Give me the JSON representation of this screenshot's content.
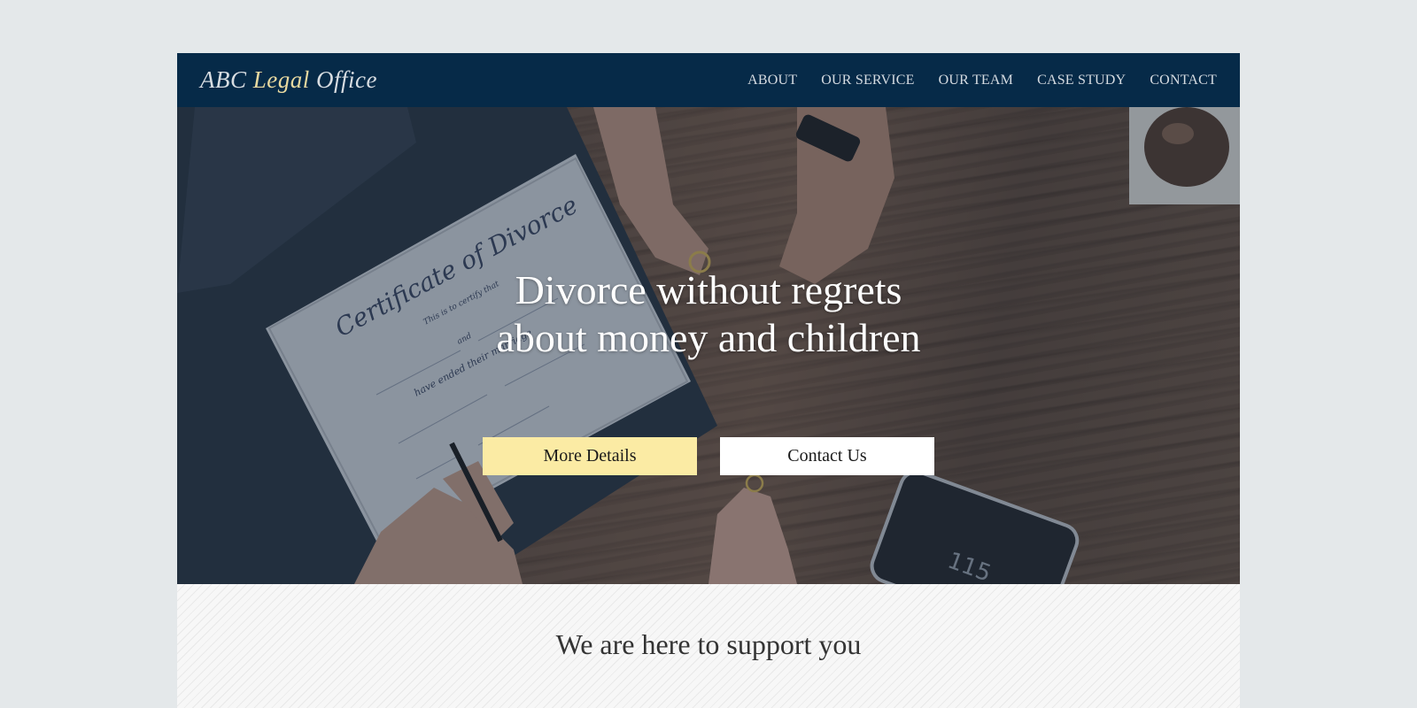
{
  "brand": {
    "logo_part1": "ABC ",
    "logo_part2": "Legal",
    "logo_part3": " Office"
  },
  "nav": {
    "items": [
      {
        "label": "ABOUT"
      },
      {
        "label": "OUR SERVICE"
      },
      {
        "label": "OUR TEAM"
      },
      {
        "label": "CASE STUDY"
      },
      {
        "label": "CONTACT"
      }
    ]
  },
  "hero": {
    "title_line1": "Divorce without regrets",
    "title_line2": "about money and children",
    "image_text": {
      "certificate_title": "Certificate of Divorce",
      "certify_line": "This is to certify that",
      "and_line": "and",
      "ended_line": "have ended their marriage",
      "phone_time": "115"
    },
    "buttons": {
      "details_label": "More Details",
      "contact_label": "Contact Us"
    }
  },
  "support": {
    "title": "We are here to support you"
  },
  "colors": {
    "nav_bg": "#062a48",
    "page_bg": "#e4e8ea",
    "details_button": "#fbeba4",
    "contact_button": "#ffffff",
    "logo_accent": "#e8d9a0"
  }
}
